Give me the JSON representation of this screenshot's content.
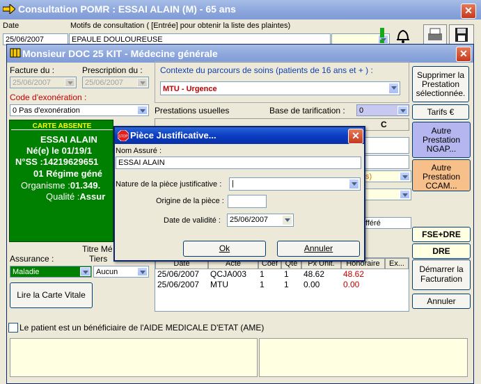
{
  "outer_window": {
    "title": "Consultation POMR : ESSAI ALAIN (M) -  65 ans",
    "date_label": "Date",
    "date_value": "25/06/2007",
    "motifs_label": "Motifs de consultation ( [Entrée]  pour obtenir la liste des plaintes)",
    "motifs_value": "EPAULE DOULOUREUSE"
  },
  "inner_window": {
    "title": "Monsieur DOC 25 KIT - Médecine générale",
    "facture_label": "Facture du :",
    "facture_value": "25/06/2007",
    "prescription_label": "Prescription du :",
    "prescription_value": "25/06/2007",
    "exoneration_label": "Code d'exonération :",
    "exoneration_value": "0 Pas d'exonération",
    "card": {
      "header": "CARTE ABSENTE",
      "name": "ESSAI ALAIN",
      "born": "Né(e) le 01/19/1",
      "nss": "N°SS :14219629651",
      "regime": "01 Régime géné",
      "organisme_label": "Organisme :",
      "organisme_value": "01.349.",
      "qualite_label": "Qualité :",
      "qualite_value": "Assur"
    },
    "titre_label": "Titre Mé",
    "assurance_label": "Assurance :",
    "assurance_value": "Maladie",
    "tiers_label": "Tiers",
    "tiers_value": "Aucun",
    "lire_carte_label": "Lire la Carte Vitale",
    "contexte_label": "Contexte du parcours de soins (patients de 16 ans et + ) :",
    "contexte_value": "MTU - Urgence",
    "prestations_usuelles": "Prestations usuelles",
    "base_tarif_label": "Base de tarification :",
    "base_tarif_value": "0",
    "col_c": "C",
    "partial_s": "s)",
    "partial_differe": "fféré",
    "right_buttons": {
      "supprimer": "Supprimer la Prestation sélectionnée.",
      "tarifs": "Tarifs €",
      "ngap": "Autre Prestation NGAP...",
      "ccam": "Autre Prestation CCAM...",
      "fse": "FSE+DRE",
      "dre": "DRE",
      "facturation": "Démarrer la Facturation",
      "annuler": "Annuler"
    },
    "table": {
      "headers": [
        "Date",
        "Acte",
        "Coef",
        "Qté",
        "Px Unit.",
        "Honoraire",
        "Ex..."
      ],
      "rows": [
        {
          "date": "25/06/2007",
          "acte": "QCJA003",
          "coef": "1",
          "qte": "1",
          "px": "48.62",
          "hono": "48.62"
        },
        {
          "date": "25/06/2007",
          "acte": "MTU",
          "coef": "1",
          "qte": "1",
          "px": "0.00",
          "hono": "0.00"
        }
      ]
    },
    "ame_label": "Le patient est un bénéficiaire de l'AIDE MEDICALE D'ETAT (AME)"
  },
  "dialog": {
    "title": "Pièce Justificative...",
    "nom_label": "Nom Assuré :",
    "nom_value": "ESSAI ALAIN",
    "nature_label": "Nature de la pièce justificative :",
    "nature_value": "|",
    "origine_label": "Origine de la pièce :",
    "origine_value": "",
    "validite_label": "Date de validité :",
    "validite_value": "25/06/2007",
    "ok_label": "Ok",
    "annuler_label": "Annuler"
  },
  "colors": {
    "title_blue": "#7f9bd6",
    "dialog_blue": "#0a3dc2",
    "card_green": "#008000",
    "honoraire_red": "#c00000",
    "lavender": "#b5b5f0",
    "orange": "#f7c08a",
    "pale_yellow": "#ffffe1"
  }
}
